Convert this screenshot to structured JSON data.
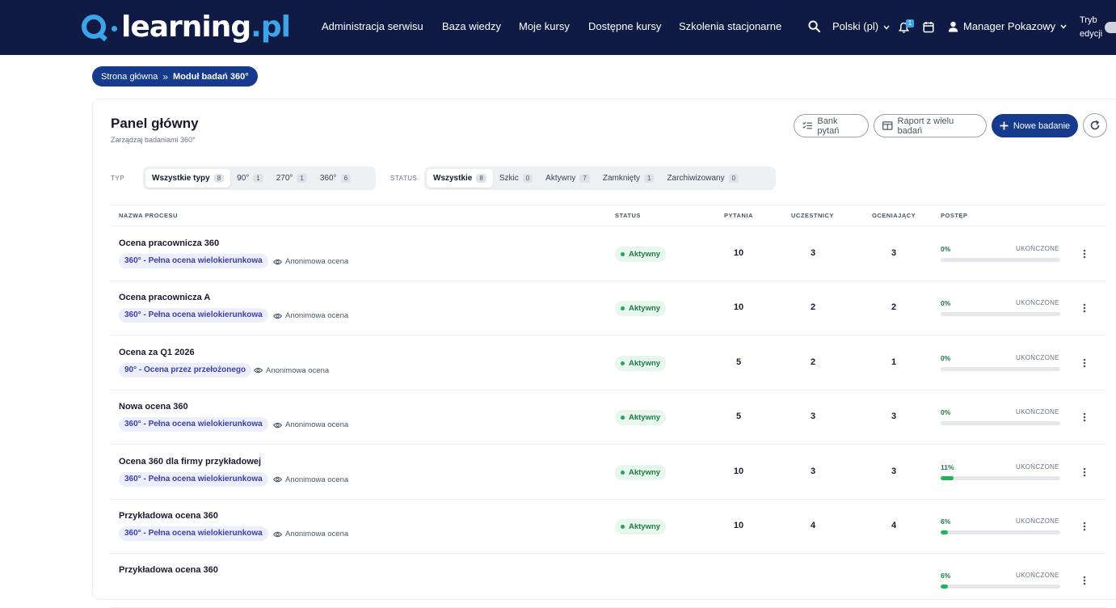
{
  "brand": {
    "logo_text_main": "learning",
    "logo_text_suffix": ".pl"
  },
  "nav": {
    "items": [
      "Administracja serwisu",
      "Baza wiedzy",
      "Moje kursy",
      "Dostępne kursy",
      "Szkolenia stacjonarne"
    ],
    "language": "Polski (pl)",
    "notifications_count": "1",
    "user_name": "Manager Pokazowy",
    "edit_mode_line1": "Tryb",
    "edit_mode_line2": "edycji"
  },
  "breadcrumb": {
    "home": "Strona główna",
    "current": "Moduł badań 360°"
  },
  "header": {
    "title": "Panel główny",
    "subtitle": "Zarządzaj badaniami 360°",
    "btn_question_bank": "Bank pytań",
    "btn_multi_report": "Raport z wielu badań",
    "btn_new": "Nowe badanie"
  },
  "filters": {
    "type_label": "TYP",
    "type_options": [
      {
        "label": "Wszystkie typy",
        "count": "8"
      },
      {
        "label": "90°",
        "count": "1"
      },
      {
        "label": "270°",
        "count": "1"
      },
      {
        "label": "360°",
        "count": "6"
      }
    ],
    "status_label": "STATUS",
    "status_options": [
      {
        "label": "Wszystkie",
        "count": "8"
      },
      {
        "label": "Szkic",
        "count": "0"
      },
      {
        "label": "Aktywny",
        "count": "7"
      },
      {
        "label": "Zamknięty",
        "count": "1"
      },
      {
        "label": "Zarchiwizowany",
        "count": "0"
      }
    ]
  },
  "table": {
    "headers": [
      "NAZWA PROCESU",
      "STATUS",
      "PYTANIA",
      "UCZESTNICY",
      "OCENIAJĄCY",
      "POSTĘP"
    ],
    "progress_done_label": "UKOŃCZONE",
    "rows": [
      {
        "name": "Ocena pracownicza 360",
        "type": "360° - Pełna ocena wielokierunkowa",
        "anon": "Anonimowa ocena",
        "status": "Aktywny",
        "questions": "10",
        "participants": "3",
        "raters": "3",
        "progress_text": "0%",
        "progress": 0
      },
      {
        "name": "Ocena pracownicza A",
        "type": "360° - Pełna ocena wielokierunkowa",
        "anon": "Anonimowa ocena",
        "status": "Aktywny",
        "questions": "10",
        "participants": "2",
        "raters": "2",
        "progress_text": "0%",
        "progress": 0
      },
      {
        "name": "Ocena za Q1 2026",
        "type": "90° - Ocena przez przełożonego",
        "anon": "Anonimowa ocena",
        "status": "Aktywny",
        "questions": "5",
        "participants": "2",
        "raters": "1",
        "progress_text": "0%",
        "progress": 0
      },
      {
        "name": "Nowa ocena 360",
        "type": "360° - Pełna ocena wielokierunkowa",
        "anon": "Anonimowa ocena",
        "status": "Aktywny",
        "questions": "5",
        "participants": "3",
        "raters": "3",
        "progress_text": "0%",
        "progress": 0
      },
      {
        "name": "Ocena 360 dla firmy przykładowej",
        "type": "360° - Pełna ocena wielokierunkowa",
        "anon": "Anonimowa ocena",
        "status": "Aktywny",
        "questions": "10",
        "participants": "3",
        "raters": "3",
        "progress_text": "11%",
        "progress": 11
      },
      {
        "name": "Przykładowa ocena 360",
        "type": "360° - Pełna ocena wielokierunkowa",
        "anon": "Anonimowa ocena",
        "status": "Aktywny",
        "questions": "10",
        "participants": "4",
        "raters": "4",
        "progress_text": "6%",
        "progress": 6
      },
      {
        "name": "Przykładowa ocena 360",
        "type": "",
        "anon": "",
        "status": "",
        "questions": "",
        "participants": "",
        "raters": "",
        "progress_text": "6%",
        "progress": 6
      }
    ]
  },
  "colors": {
    "topbar": "#0f1b45",
    "accent": "#163a8c",
    "logo_blue": "#3da4e8",
    "success": "#22b35e"
  }
}
